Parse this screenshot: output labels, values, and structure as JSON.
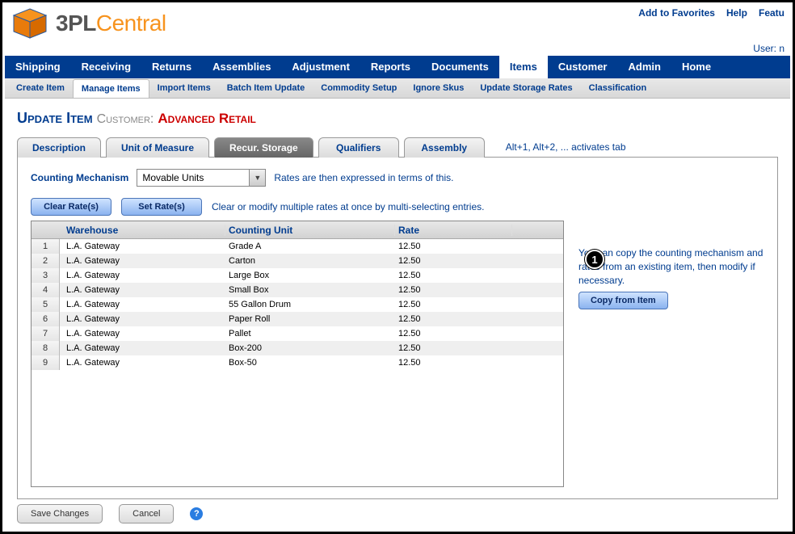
{
  "brand": {
    "part1": "3PL",
    "part2": "Central"
  },
  "top_links": {
    "favorites": "Add to Favorites",
    "help": "Help",
    "features": "Featu"
  },
  "user_row": {
    "label": "User:",
    "value": "n"
  },
  "main_nav": [
    "Shipping",
    "Receiving",
    "Returns",
    "Assemblies",
    "Adjustment",
    "Reports",
    "Documents",
    "Items",
    "Customer",
    "Admin",
    "Home"
  ],
  "main_nav_active": 7,
  "sub_nav": [
    "Create Item",
    "Manage Items",
    "Import Items",
    "Batch Item Update",
    "Commodity Setup",
    "Ignore Skus",
    "Update Storage Rates",
    "Classification"
  ],
  "sub_nav_active": 1,
  "page": {
    "title": "Update Item",
    "customer_label": "Customer:",
    "customer_name": "Advanced Retail"
  },
  "tabs": [
    "Description",
    "Unit of Measure",
    "Recur. Storage",
    "Qualifiers",
    "Assembly"
  ],
  "tabs_active": 2,
  "tabs_hint": "Alt+1, Alt+2, ... activates tab",
  "counting": {
    "label": "Counting Mechanism",
    "value": "Movable Units",
    "hint": "Rates are then expressed in terms of this."
  },
  "rate_buttons": {
    "clear": "Clear Rate(s)",
    "set": "Set Rate(s)",
    "hint": "Clear or modify multiple rates at once by multi-selecting entries."
  },
  "grid": {
    "headers": {
      "warehouse": "Warehouse",
      "counting_unit": "Counting Unit",
      "rate": "Rate"
    },
    "rows": [
      {
        "n": "1",
        "wh": "L.A. Gateway",
        "cu": "Grade A",
        "rate": "12.50"
      },
      {
        "n": "2",
        "wh": "L.A. Gateway",
        "cu": "Carton",
        "rate": "12.50"
      },
      {
        "n": "3",
        "wh": "L.A. Gateway",
        "cu": "Large Box",
        "rate": "12.50"
      },
      {
        "n": "4",
        "wh": "L.A. Gateway",
        "cu": "Small Box",
        "rate": "12.50"
      },
      {
        "n": "5",
        "wh": "L.A. Gateway",
        "cu": "55 Gallon Drum",
        "rate": "12.50"
      },
      {
        "n": "6",
        "wh": "L.A. Gateway",
        "cu": "Paper Roll",
        "rate": "12.50"
      },
      {
        "n": "7",
        "wh": "L.A. Gateway",
        "cu": "Pallet",
        "rate": "12.50"
      },
      {
        "n": "8",
        "wh": "L.A. Gateway",
        "cu": "Box-200",
        "rate": "12.50"
      },
      {
        "n": "9",
        "wh": "L.A. Gateway",
        "cu": "Box-50",
        "rate": "12.50"
      }
    ]
  },
  "copy": {
    "text": "You can copy the counting mechanism and rates from an existing item, then modify if necessary.",
    "button": "Copy from Item"
  },
  "badge": "1",
  "bottom": {
    "save": "Save Changes",
    "cancel": "Cancel"
  }
}
